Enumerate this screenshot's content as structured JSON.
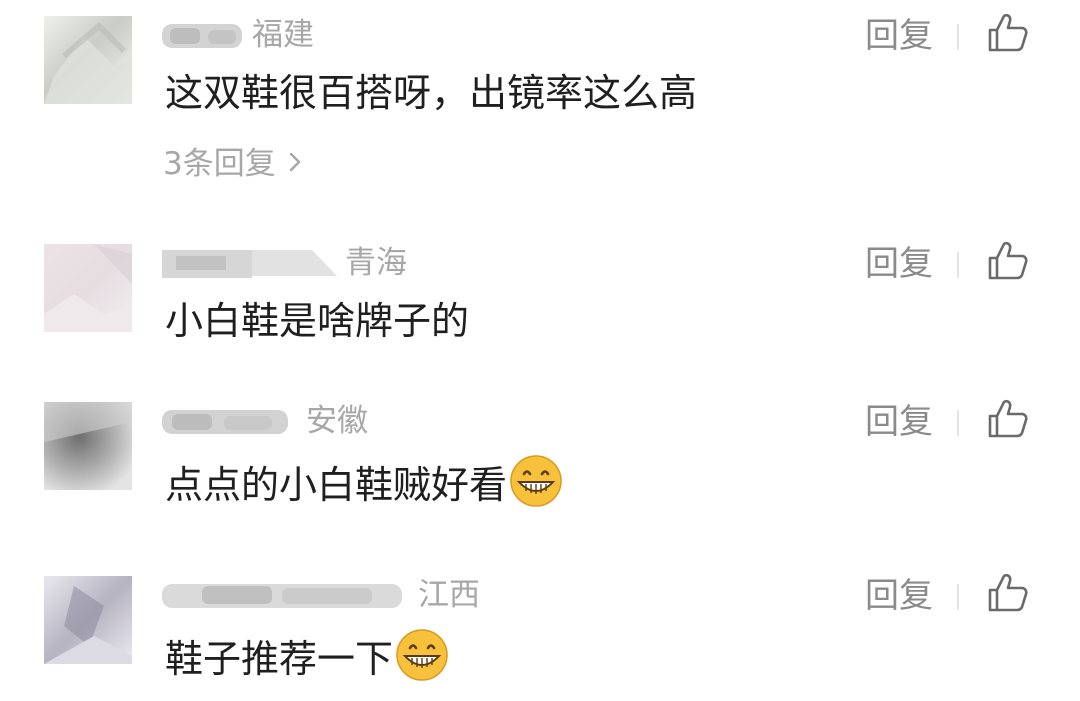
{
  "comments": [
    {
      "location": "福建",
      "text": "这双鞋很百搭呀，出镜率这么高",
      "reply_label": "回复",
      "replies_link": "3条回复",
      "emoji": ""
    },
    {
      "location": "青海",
      "text": "小白鞋是啥牌子的",
      "reply_label": "回复",
      "emoji": ""
    },
    {
      "location": "安徽",
      "text": "点点的小白鞋贼好看",
      "reply_label": "回复",
      "emoji": "grinning-face-emoji"
    },
    {
      "location": "江西",
      "text": "鞋子推荐一下",
      "reply_label": "回复",
      "emoji": "grinning-face-emoji"
    }
  ],
  "icons": {
    "like": "thumbs-up-icon",
    "more": "chevron-right-icon"
  },
  "colors": {
    "text": "#1f1f1f",
    "meta": "#a7a7a7",
    "reply": "#8a8a8a",
    "emoji_face": "#f7c13b"
  }
}
